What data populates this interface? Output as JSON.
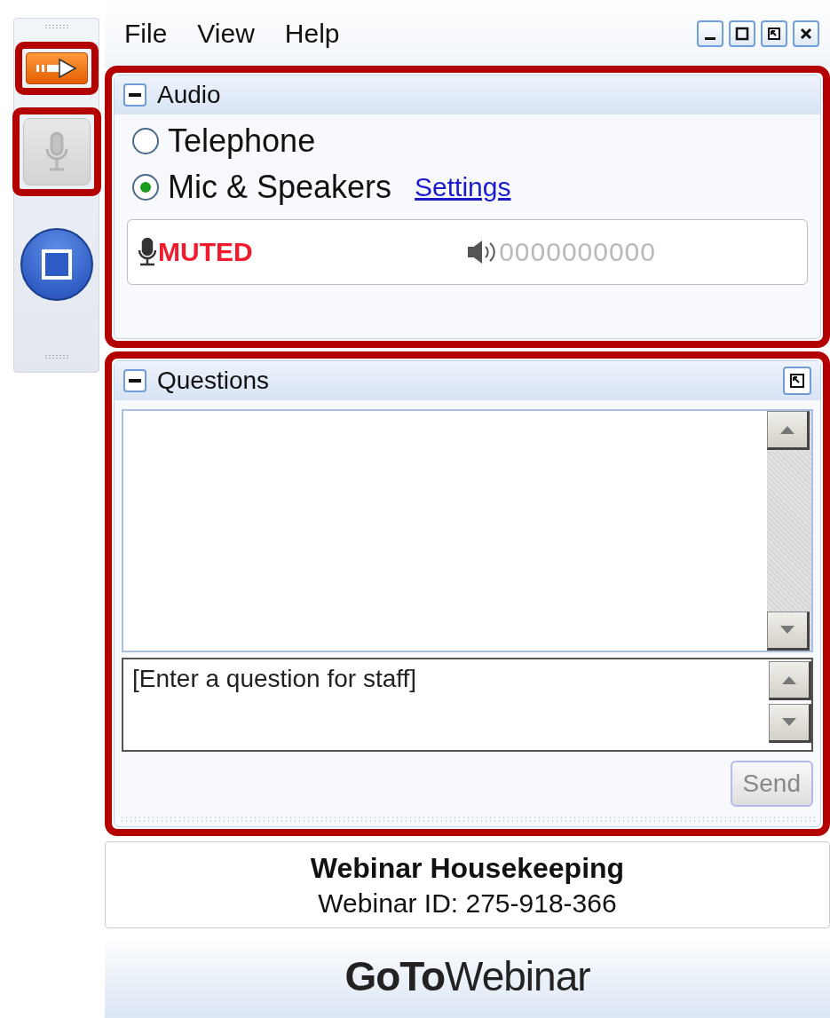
{
  "toolbar": {
    "buttons": [
      {
        "kind": "share",
        "highlighted": true
      },
      {
        "kind": "mic",
        "highlighted": true,
        "disabled": true
      },
      {
        "kind": "stop",
        "highlighted": false
      }
    ]
  },
  "menu": [
    {
      "label": "File"
    },
    {
      "label": "View"
    },
    {
      "label": "Help"
    }
  ],
  "audio": {
    "title": "Audio",
    "highlighted": true,
    "options": [
      {
        "label": "Telephone",
        "selected": false
      },
      {
        "label": "Mic & Speakers",
        "selected": true
      }
    ],
    "settings_link": "Settings",
    "mic_status": "MUTED",
    "speaker_level": "0000000000"
  },
  "questions": {
    "title": "Questions",
    "highlighted": true,
    "placeholder": "[Enter a question for staff]",
    "send": {
      "label": "Send",
      "disabled": true
    }
  },
  "info": {
    "title": "Webinar Housekeeping",
    "webinar_id": "Webinar ID: 275-918-366"
  },
  "logo": "**GoTo**Webinar"
}
